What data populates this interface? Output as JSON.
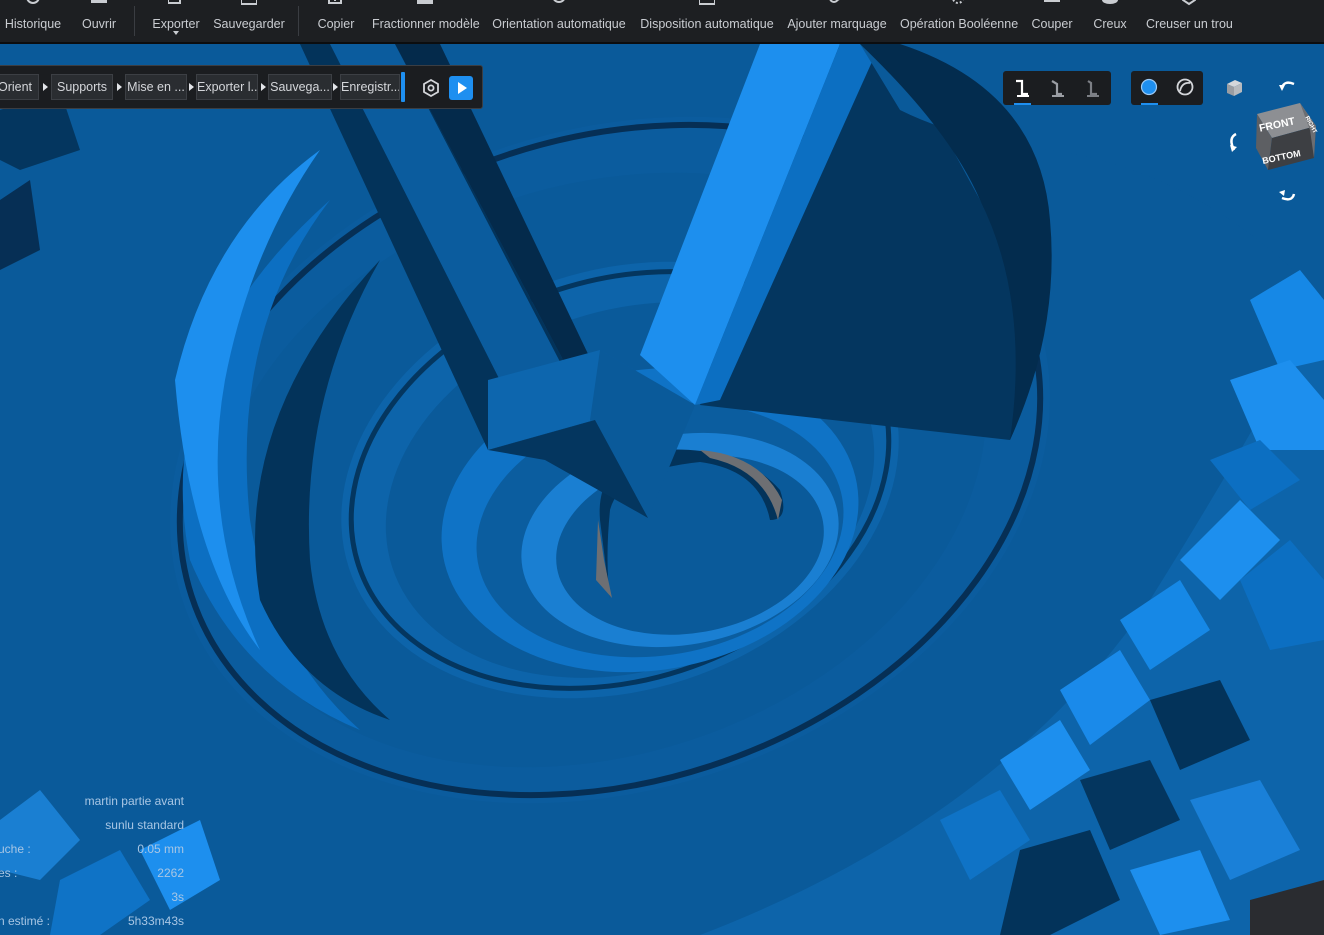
{
  "toolbar": {
    "items": [
      {
        "label": "Historique",
        "icon": "history-icon"
      },
      {
        "label": "Ouvrir",
        "icon": "open-icon"
      },
      {
        "label": "Exporter",
        "icon": "export-icon"
      },
      {
        "label": "Sauvegarder",
        "icon": "save-icon"
      },
      {
        "label": "Copier",
        "icon": "copy-icon"
      },
      {
        "label": "Fractionner modèle",
        "icon": "split-model-icon"
      },
      {
        "label": "Orientation automatique",
        "icon": "auto-orient-icon"
      },
      {
        "label": "Disposition automatique",
        "icon": "auto-layout-icon"
      },
      {
        "label": "Ajouter marquage",
        "icon": "add-label-icon"
      },
      {
        "label": "Opération Booléenne",
        "icon": "boolean-icon"
      },
      {
        "label": "Couper",
        "icon": "cut-icon"
      },
      {
        "label": "Creux",
        "icon": "hollow-icon"
      },
      {
        "label": "Creuser un trou",
        "icon": "drill-hole-icon"
      }
    ]
  },
  "workflow": {
    "steps": [
      {
        "label": "Orient"
      },
      {
        "label": "Supports"
      },
      {
        "label": "Mise en ..."
      },
      {
        "label": "Exporter l..."
      },
      {
        "label": "Sauvega..."
      },
      {
        "label": "Enregistr..."
      }
    ],
    "settings_icon": "gear-icon",
    "run_icon": "play-icon"
  },
  "view_controls": {
    "support_modes": [
      "support-mode-1-icon",
      "support-mode-2-icon",
      "support-mode-3-icon"
    ],
    "render_modes": [
      "solid-view-icon",
      "xray-view-icon"
    ],
    "cube_faces": {
      "front": "FRONT",
      "bottom": "BOTTOM",
      "side": "RIGHT"
    }
  },
  "info_panel": {
    "rows": [
      {
        "key": "",
        "value": "martin partie avant"
      },
      {
        "key": "",
        "value": "sunlu standard"
      },
      {
        "key": "uche :",
        "value": "0.05 mm"
      },
      {
        "key": "es :",
        "value": "2262"
      },
      {
        "key": "",
        "value": "3s"
      },
      {
        "key": "n estimé :",
        "value": "5h33m43s"
      }
    ]
  },
  "colors": {
    "model_base": "#0a5a9a",
    "model_light": "#1d8fee",
    "model_dark": "#03335a",
    "accent": "#1e8ff0",
    "toolbar_bg": "#1d1f22"
  }
}
